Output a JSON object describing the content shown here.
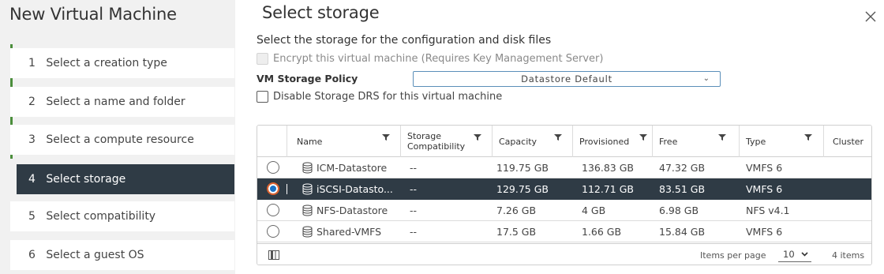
{
  "wizard": {
    "title": "New Virtual Machine",
    "steps": [
      {
        "num": "1",
        "label": "Select a creation type"
      },
      {
        "num": "2",
        "label": "Select a name and folder"
      },
      {
        "num": "3",
        "label": "Select a compute resource"
      },
      {
        "num": "4",
        "label": "Select storage"
      },
      {
        "num": "5",
        "label": "Select compatibility"
      },
      {
        "num": "6",
        "label": "Select a guest OS"
      }
    ],
    "active_step": 4
  },
  "page": {
    "title": "Select storage",
    "subtitle": "Select the storage for the configuration and disk files",
    "close_icon": "close-icon",
    "encrypt_label": "Encrypt this virtual machine (Requires Key Management Server)",
    "encrypt_checked": false,
    "encrypt_disabled": true,
    "policy_label": "VM Storage Policy",
    "policy_value": "Datastore Default",
    "disable_drs_label": "Disable Storage DRS for this virtual machine",
    "disable_drs_checked": false
  },
  "grid": {
    "columns": [
      {
        "key": "name",
        "label": "Name"
      },
      {
        "key": "compat",
        "label": "Storage Compatibility"
      },
      {
        "key": "capacity",
        "label": "Capacity"
      },
      {
        "key": "provisioned",
        "label": "Provisioned"
      },
      {
        "key": "free",
        "label": "Free"
      },
      {
        "key": "type",
        "label": "Type"
      },
      {
        "key": "cluster",
        "label": "Cluster"
      }
    ],
    "rows": [
      {
        "name": "ICM-Datastore",
        "compat": "--",
        "capacity": "119.75 GB",
        "provisioned": "136.83 GB",
        "free": "47.32 GB",
        "type": "VMFS 6",
        "cluster": "",
        "selected": false
      },
      {
        "name": "iSCSI-Datasto...",
        "compat": "--",
        "capacity": "129.75 GB",
        "provisioned": "112.71 GB",
        "free": "83.51 GB",
        "type": "VMFS 6",
        "cluster": "",
        "selected": true
      },
      {
        "name": "NFS-Datastore",
        "compat": "--",
        "capacity": "7.26 GB",
        "provisioned": "4 GB",
        "free": "6.98 GB",
        "type": "NFS v4.1",
        "cluster": "",
        "selected": false
      },
      {
        "name": "Shared-VMFS",
        "compat": "--",
        "capacity": "17.5 GB",
        "provisioned": "1.66 GB",
        "free": "15.84 GB",
        "type": "VMFS 6",
        "cluster": "",
        "selected": false
      }
    ],
    "footer": {
      "items_per_page_label": "Items per page",
      "items_per_page_value": "10",
      "count_label": "4 items"
    }
  },
  "colors": {
    "selected_bg": "#2f3b45",
    "progress": "#4b8e3c",
    "radio_selected": "#1b73c8",
    "focus_ring": "#e0632e"
  }
}
